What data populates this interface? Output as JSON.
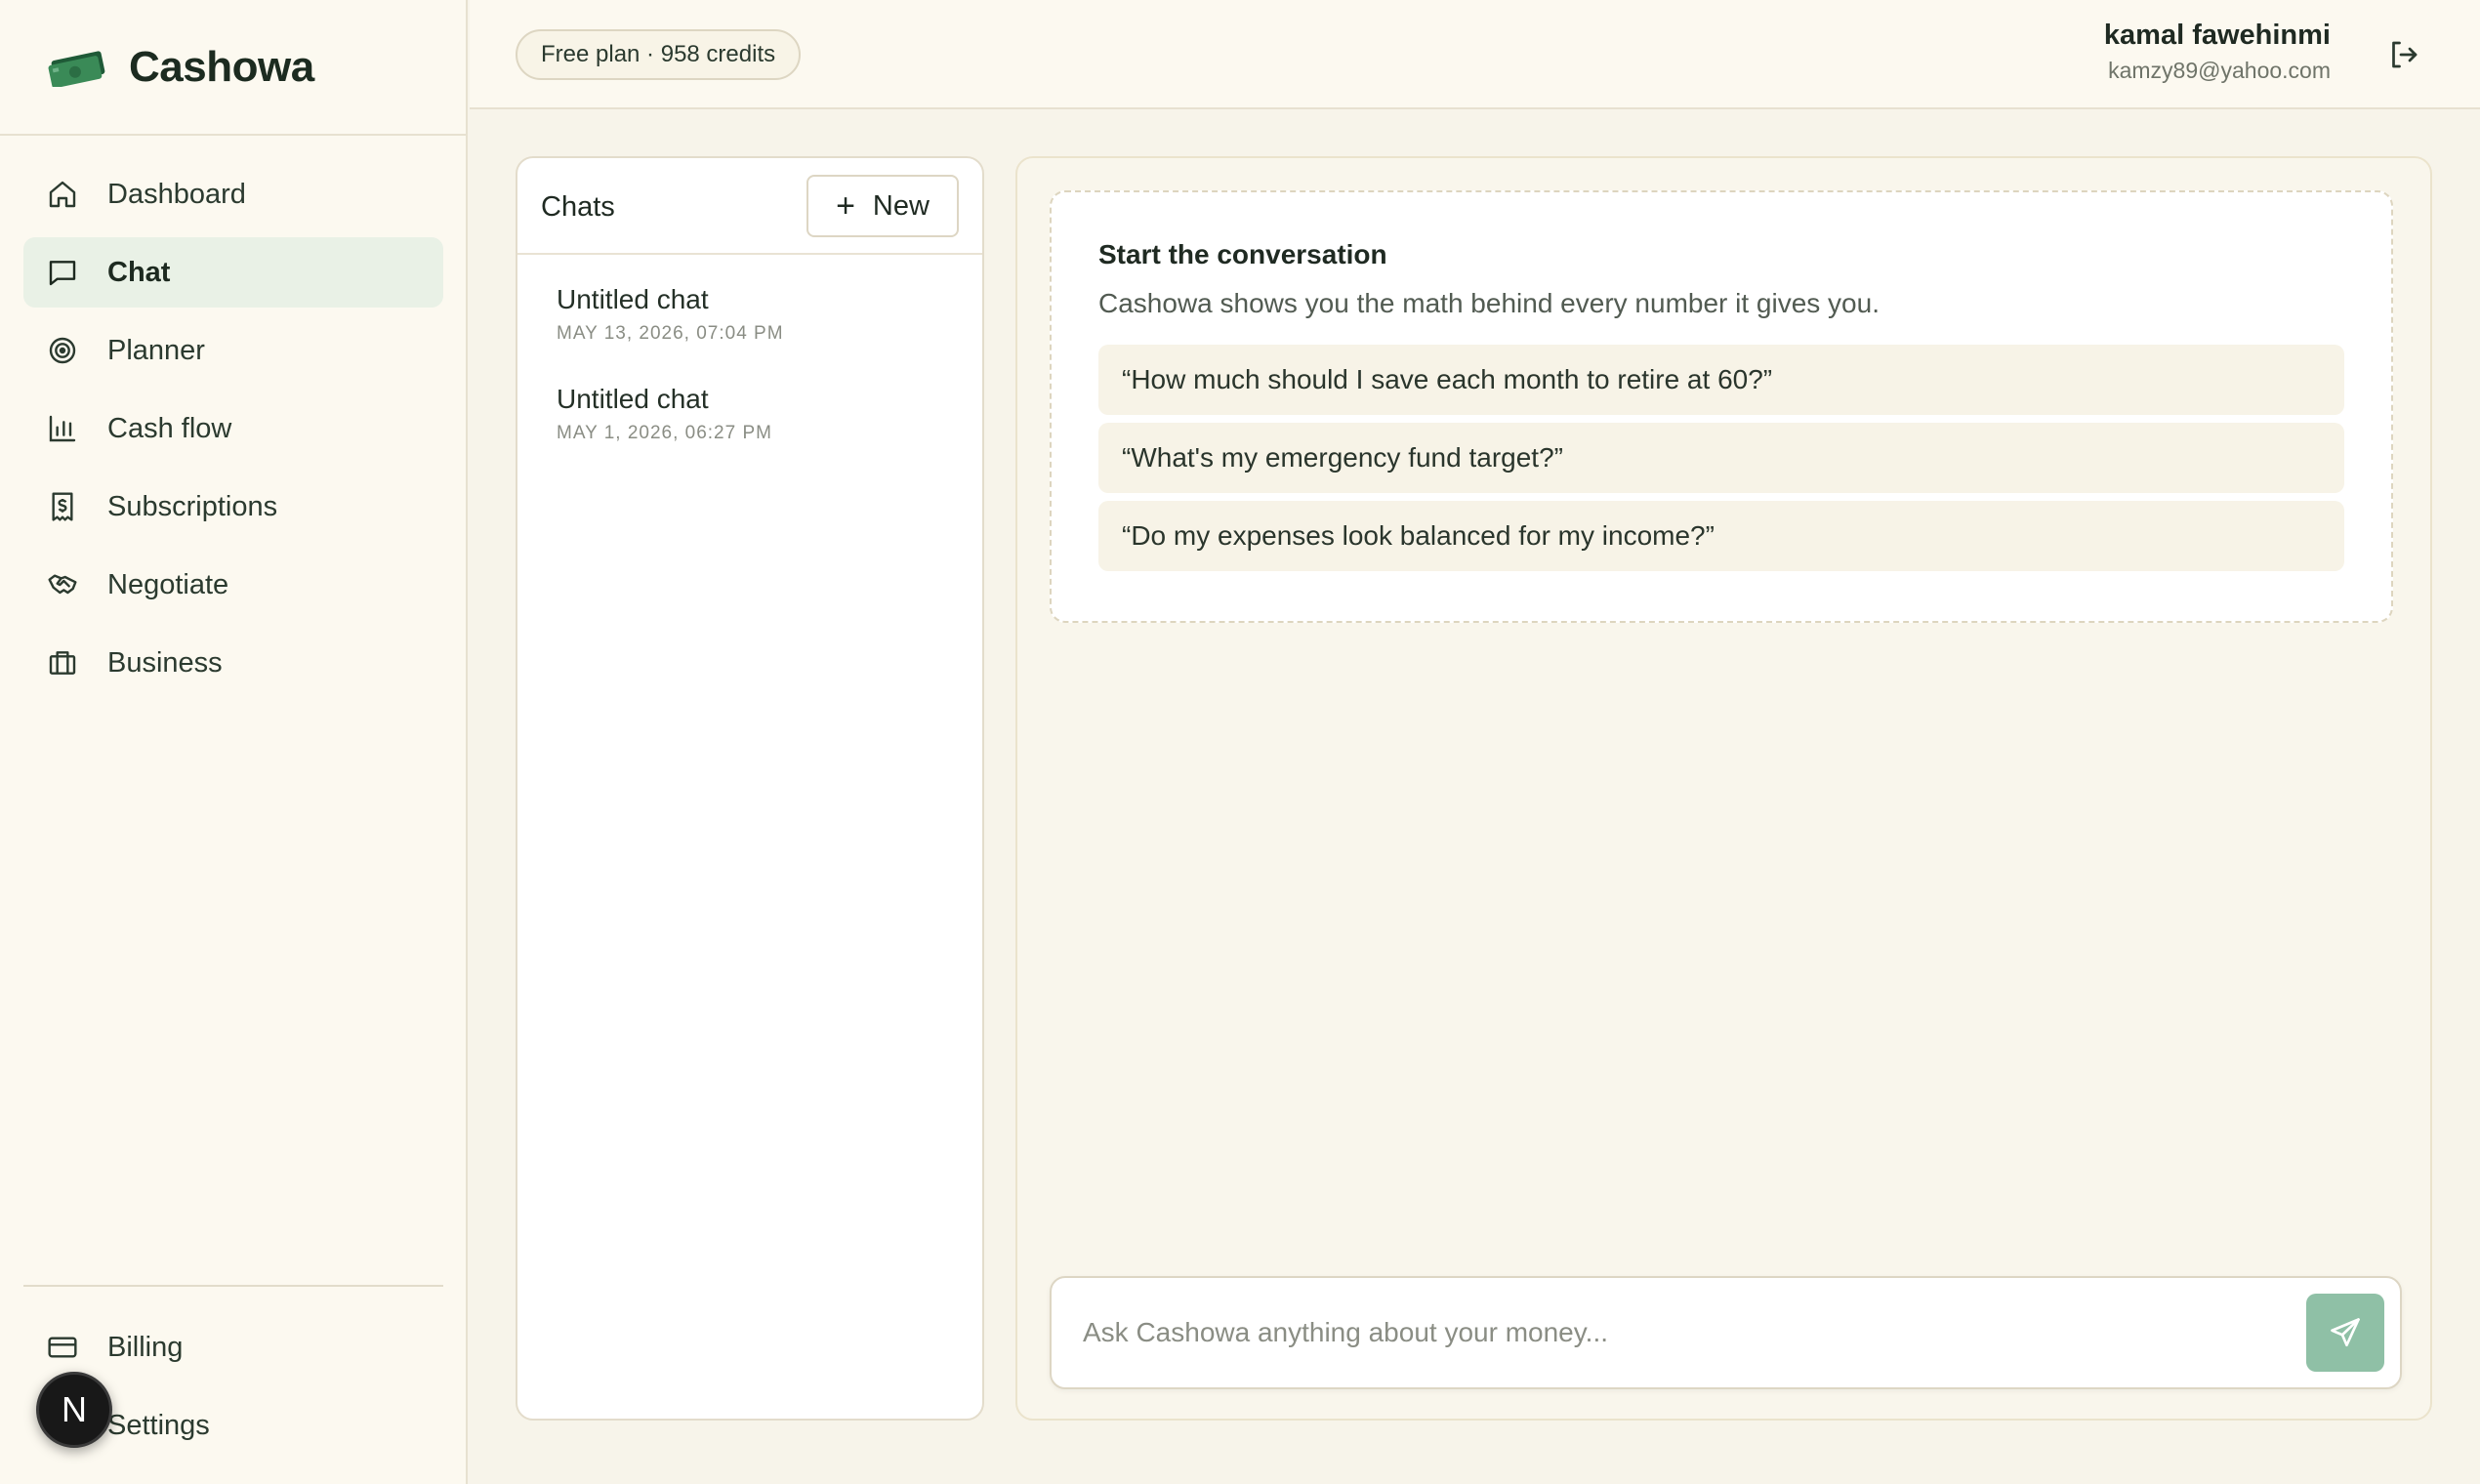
{
  "app": {
    "name": "Cashowa",
    "logo": "cash-logo-icon"
  },
  "nav": {
    "items": [
      {
        "label": "Dashboard",
        "icon": "home-icon"
      },
      {
        "label": "Chat",
        "icon": "chat-bubble-icon",
        "active": true
      },
      {
        "label": "Planner",
        "icon": "target-icon"
      },
      {
        "label": "Cash flow",
        "icon": "bar-chart-icon"
      },
      {
        "label": "Subscriptions",
        "icon": "receipt-icon"
      },
      {
        "label": "Negotiate",
        "icon": "handshake-icon"
      },
      {
        "label": "Business",
        "icon": "briefcase-icon"
      }
    ],
    "bottom": [
      {
        "label": "Billing",
        "icon": "credit-card-icon"
      },
      {
        "label": "Settings",
        "icon": "settings-icon"
      }
    ],
    "badge": "N"
  },
  "header": {
    "plan": "Free plan · 958 credits",
    "user_name": "kamal fawehinmi",
    "user_email": "kamzy89@yahoo.com",
    "logout_icon": "logout-icon"
  },
  "chats": {
    "title": "Chats",
    "new_label": "New",
    "items": [
      {
        "name": "Untitled chat",
        "date": "MAY 13, 2026, 07:04 PM"
      },
      {
        "name": "Untitled chat",
        "date": "MAY 1, 2026, 06:27 PM"
      }
    ]
  },
  "conversation": {
    "title": "Start the conversation",
    "subtitle": "Cashowa shows you the math behind every number it gives you.",
    "prompts": [
      "“How much should I save each month to retire at 60?”",
      "“What's my emergency fund target?”",
      "“Do my expenses look balanced for my income?”"
    ],
    "placeholder": "Ask Cashowa anything about your money...",
    "send_icon": "send-icon"
  },
  "colors": {
    "accent": "#8fc0a6",
    "active_nav": "#e9f1e6",
    "brand_green": "#2e6b45"
  }
}
